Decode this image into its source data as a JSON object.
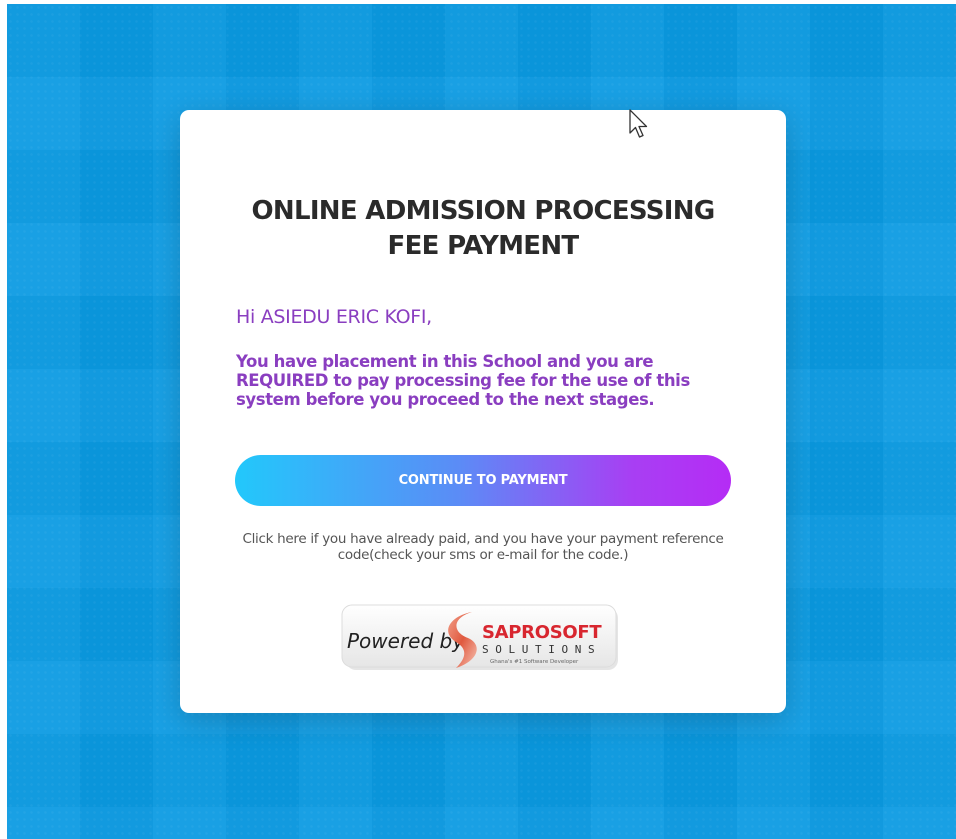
{
  "page": {
    "title_line1": "ONLINE ADMISSION PROCESSING",
    "title_line2": "FEE PAYMENT",
    "greeting": "Hi ASIEDU ERIC KOFI,",
    "message": "You have placement in this School and you are REQUIRED to pay processing fee for the use of this system before you proceed to the next stages.",
    "continue_button_label": "CONTINUE TO PAYMENT",
    "paid_link_text": "Click here if you have already paid, and you have your payment reference code(check your sms or e-mail for the code.)"
  },
  "logo": {
    "powered_by": "Powered by",
    "brand": "SAPROSOFT",
    "brand_sub": "S O L U T I O N S",
    "tagline": "Ghana's #1 Software Developer"
  },
  "colors": {
    "background": "#0a9ae2",
    "card": "#ffffff",
    "title": "#2b2b2b",
    "accent_purple": "#8a3ec0",
    "button_gradient_start": "#22c8fb",
    "button_gradient_end": "#b52cf5",
    "brand_red": "#d8262f",
    "icons": [
      "mouse-cursor-icon",
      "saprosoft-s-swoosh-icon"
    ]
  }
}
